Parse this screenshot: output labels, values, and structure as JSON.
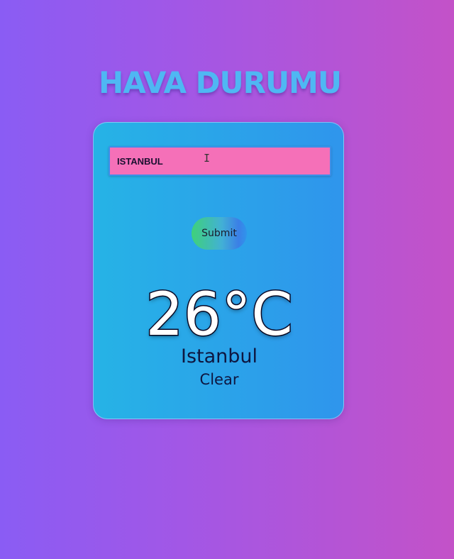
{
  "header": {
    "title": "HAVA DURUMU"
  },
  "search": {
    "value": "ISTANBUL",
    "submit_label": "Submit"
  },
  "weather": {
    "temperature": "26°C",
    "city": "Istanbul",
    "condition": "Clear"
  },
  "colors": {
    "background_start": "#8a5cf4",
    "background_end": "#c352c8",
    "title": "#4fb7f3",
    "card": "#2f95ec",
    "input": "#f570b8"
  }
}
